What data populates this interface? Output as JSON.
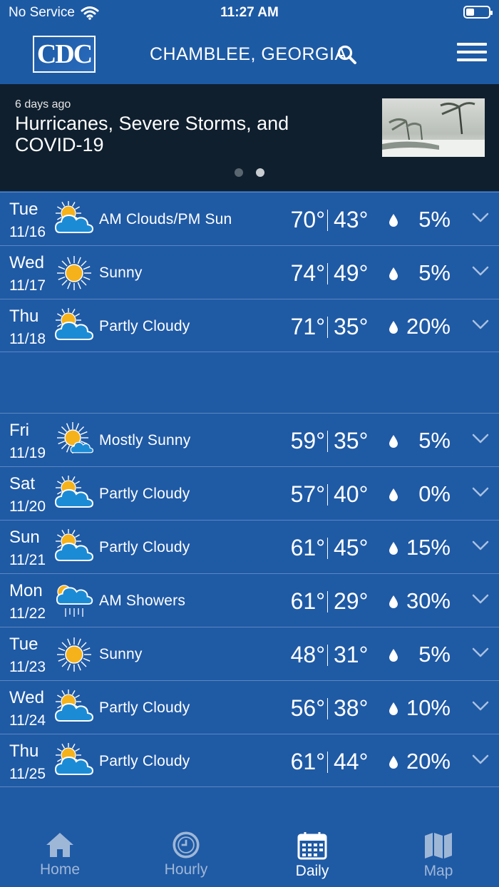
{
  "status_bar": {
    "carrier": "No Service",
    "time": "11:27 AM"
  },
  "header": {
    "logo_text": "CDC",
    "location": "CHAMBLEE, GEORGIA"
  },
  "news": {
    "age": "6 days ago",
    "headline": "Hurricanes, Severe Storms, and COVID-19",
    "page_count": 2,
    "active_page": 2
  },
  "forecast": [
    {
      "day": "Tue",
      "date": "11/16",
      "icon": "sun-cloud-icon",
      "condition": "AM Clouds/PM Sun",
      "high": "70°",
      "low": "43°",
      "precip": "5%"
    },
    {
      "day": "Wed",
      "date": "11/17",
      "icon": "sun-icon",
      "condition": "Sunny",
      "high": "74°",
      "low": "49°",
      "precip": "5%"
    },
    {
      "day": "Thu",
      "date": "11/18",
      "icon": "sun-cloud-icon",
      "condition": "Partly Cloudy",
      "high": "71°",
      "low": "35°",
      "precip": "20%"
    },
    {
      "day": "Fri",
      "date": "11/19",
      "icon": "mostly-sunny-icon",
      "condition": "Mostly Sunny",
      "high": "59°",
      "low": "35°",
      "precip": "5%"
    },
    {
      "day": "Sat",
      "date": "11/20",
      "icon": "sun-cloud-icon",
      "condition": "Partly Cloudy",
      "high": "57°",
      "low": "40°",
      "precip": "0%"
    },
    {
      "day": "Sun",
      "date": "11/21",
      "icon": "sun-cloud-icon",
      "condition": "Partly Cloudy",
      "high": "61°",
      "low": "45°",
      "precip": "15%"
    },
    {
      "day": "Mon",
      "date": "11/22",
      "icon": "showers-icon",
      "condition": "AM Showers",
      "high": "61°",
      "low": "29°",
      "precip": "30%"
    },
    {
      "day": "Tue",
      "date": "11/23",
      "icon": "sun-icon",
      "condition": "Sunny",
      "high": "48°",
      "low": "31°",
      "precip": "5%"
    },
    {
      "day": "Wed",
      "date": "11/24",
      "icon": "sun-cloud-icon",
      "condition": "Partly Cloudy",
      "high": "56°",
      "low": "38°",
      "precip": "10%"
    },
    {
      "day": "Thu",
      "date": "11/25",
      "icon": "sun-cloud-icon",
      "condition": "Partly Cloudy",
      "high": "61°",
      "low": "44°",
      "precip": "20%"
    }
  ],
  "tabs": [
    {
      "label": "Home",
      "icon": "home-icon",
      "active": false
    },
    {
      "label": "Hourly",
      "icon": "clock-icon",
      "active": false
    },
    {
      "label": "Daily",
      "icon": "calendar-icon",
      "active": true
    },
    {
      "label": "Map",
      "icon": "map-icon",
      "active": false
    }
  ],
  "colors": {
    "background": "#1f5aa5",
    "news_background": "#0f1f2e",
    "divider": "#5e87bf",
    "sun": "#f6b21b",
    "cloud": "#1c8bd6",
    "inactive_tab": "#9fb7d6"
  }
}
